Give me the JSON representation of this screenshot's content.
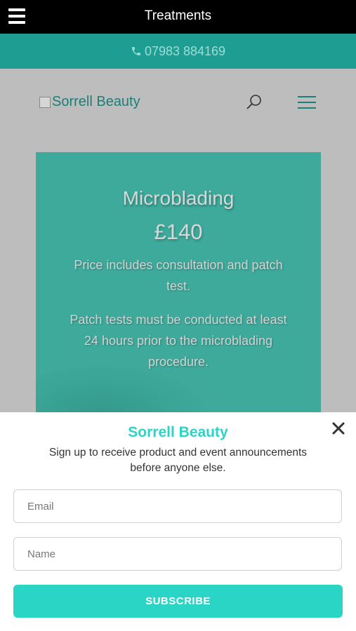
{
  "appbar": {
    "title": "Treatments",
    "menu_icon": "hamburger-menu-icon"
  },
  "contact": {
    "phone": "07983 884169",
    "icon": "phone-icon"
  },
  "site": {
    "logo_alt": "Sorrell Beauty",
    "search_icon": "search-icon",
    "menu_icon": "hamburger-menu-icon",
    "accent_color": "#1c7f77"
  },
  "card": {
    "title": "Microblading",
    "price": "£140",
    "paragraphs": [
      "Price includes consultation and patch test.",
      "Patch tests must be conducted at least 24 hours prior to the microblading procedure."
    ],
    "background_color": "#3eaa9c"
  },
  "modal": {
    "title": "Sorrell Beauty",
    "subtitle": "Sign up to receive product and event announcements before anyone else.",
    "email_placeholder": "Email",
    "email_value": "",
    "name_placeholder": "Name",
    "name_value": "",
    "subscribe_label": "SUBSCRIBE",
    "close_icon": "close-icon",
    "brand_color": "#2bd5c5"
  }
}
